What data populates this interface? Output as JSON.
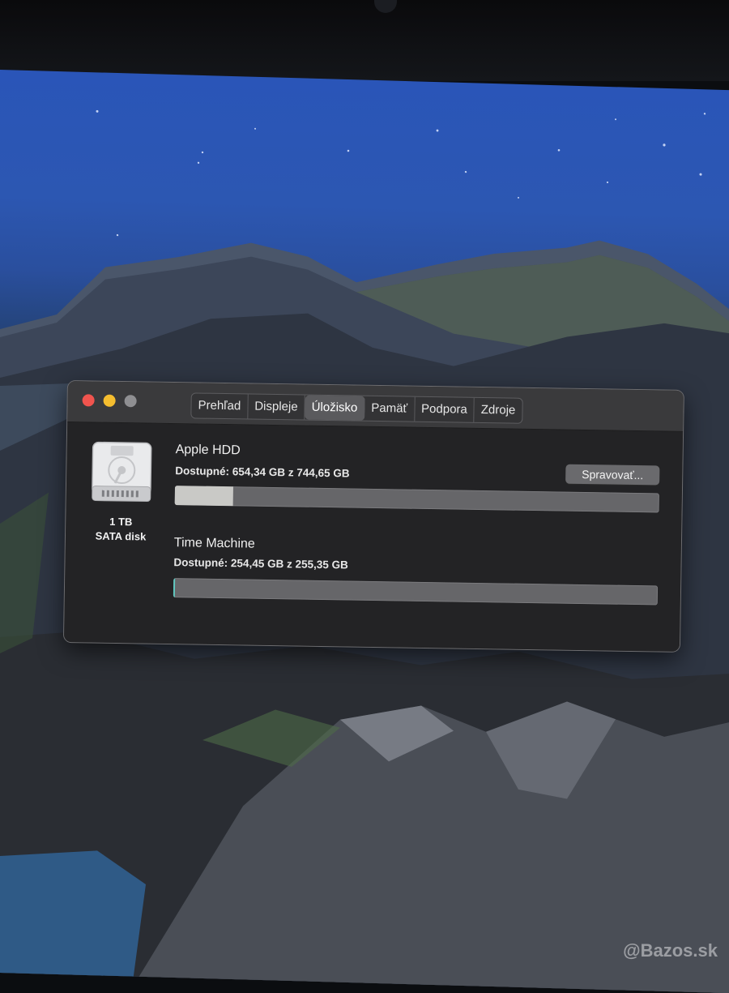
{
  "window": {
    "tabs": [
      {
        "label": "Prehľad"
      },
      {
        "label": "Displeje"
      },
      {
        "label": "Úložisko",
        "active": true
      },
      {
        "label": "Pamäť"
      },
      {
        "label": "Podpora"
      },
      {
        "label": "Zdroje"
      }
    ]
  },
  "disk": {
    "capacity": "1 TB",
    "type": "SATA disk",
    "icon": "hard-drive-icon"
  },
  "volumes": [
    {
      "name": "Apple HDD",
      "available": "Dostupné: 654,34 GB z 744,65 GB",
      "used_fraction": 0.12,
      "fill_color": "#c9c9c6"
    },
    {
      "name": "Time Machine",
      "available": "Dostupné: 254,45 GB z 255,35 GB",
      "used_fraction": 0.004,
      "fill_color": "#5fc8c0"
    }
  ],
  "buttons": {
    "manage": "Spravovať..."
  },
  "watermark": "@Bazos.sk",
  "colors": {
    "window_bg": "#2b2b2d",
    "close": "#f0544e",
    "minimize": "#f5bd2f",
    "zoom": "#8f8f92"
  }
}
